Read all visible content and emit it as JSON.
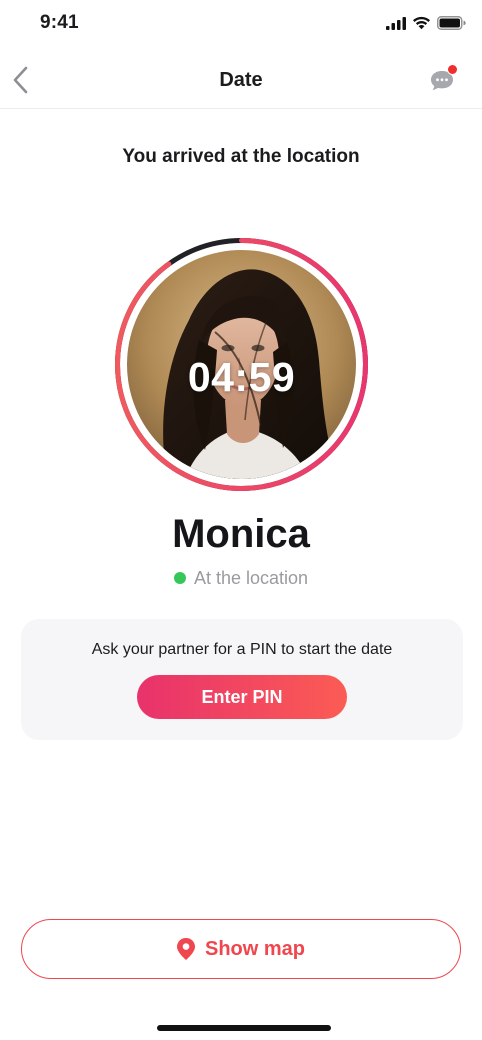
{
  "status_bar": {
    "time": "9:41",
    "icons": [
      "signal-icon",
      "wifi-icon",
      "battery-icon"
    ]
  },
  "nav": {
    "title": "Date",
    "back_icon": "chevron-left-icon",
    "chat_icon": "chat-bubble-icon",
    "has_unread": true
  },
  "main": {
    "headline": "You arrived at the location",
    "timer": "04:59",
    "timer_progress": 0.9,
    "name": "Monica",
    "status_text": "At the location",
    "status_color": "#35c759"
  },
  "pin_card": {
    "prompt": "Ask your partner for a PIN to start the date",
    "button_label": "Enter PIN"
  },
  "footer": {
    "map_button_label": "Show map",
    "map_icon": "location-pin-icon"
  },
  "colors": {
    "accent_start": "#e8326c",
    "accent_end": "#fb5c54",
    "map_accent": "#f0464e",
    "ring_track": "#222226"
  }
}
